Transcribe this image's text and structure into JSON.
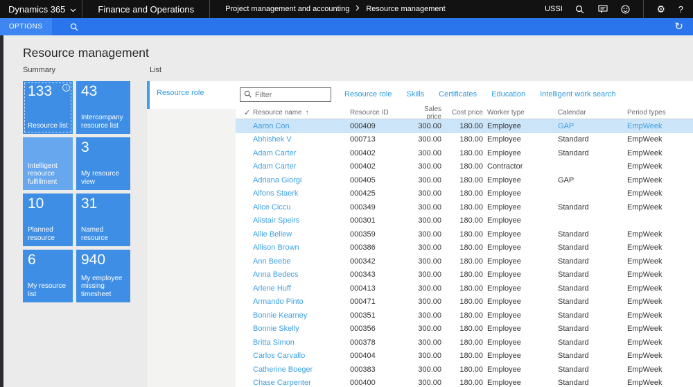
{
  "topbar": {
    "product": "Dynamics 365",
    "app": "Finance and Operations",
    "breadcrumb": {
      "parent": "Project management and accounting",
      "current": "Resource management"
    },
    "company": "USSI",
    "help_label": "?"
  },
  "actionbar": {
    "options_tab": "OPTIONS"
  },
  "page": {
    "title": "Resource management",
    "summary_label": "Summary",
    "list_label": "List"
  },
  "tiles": [
    {
      "count": "133",
      "label": "Resource list",
      "variant": "normal",
      "info": true,
      "focused": true
    },
    {
      "count": "43",
      "label": "Intercompany resource list",
      "variant": "normal"
    },
    {
      "count": "",
      "label": "Intelligent resource fulfillment",
      "variant": "light"
    },
    {
      "count": "3",
      "label": "My resource view",
      "variant": "normal"
    },
    {
      "count": "10",
      "label": "Planned resource",
      "variant": "normal"
    },
    {
      "count": "31",
      "label": "Named resource",
      "variant": "normal"
    },
    {
      "count": "6",
      "label": "My resource list",
      "variant": "normal"
    },
    {
      "count": "940",
      "label": "My employee missing timesheet",
      "variant": "normal"
    }
  ],
  "list_panel": {
    "vertical_tab": "Resource role",
    "filter_placeholder": "Filter",
    "tabs": [
      "Resource role",
      "Skills",
      "Certificates",
      "Education",
      "Intelligent work search"
    ],
    "table": {
      "check_glyph": "✓",
      "sort_arrow": "↑",
      "columns": [
        "Resource name",
        "Resource ID",
        "Sales price",
        "Cost price",
        "Worker type",
        "Calendar",
        "Period types"
      ],
      "rows": [
        {
          "name": "Aaron Con",
          "id": "000409",
          "sales": "300.00",
          "cost": "180.00",
          "worker": "Employee",
          "calendar": "GAP",
          "period": "EmpWeek",
          "selected": true
        },
        {
          "name": "Abhishek V",
          "id": "000713",
          "sales": "300.00",
          "cost": "180.00",
          "worker": "Employee",
          "calendar": "Standard",
          "period": "EmpWeek"
        },
        {
          "name": "Adam Carter",
          "id": "000402",
          "sales": "300.00",
          "cost": "180.00",
          "worker": "Employee",
          "calendar": "Standard",
          "period": "EmpWeek"
        },
        {
          "name": "Adam Carter",
          "id": "000402",
          "sales": "300.00",
          "cost": "180.00",
          "worker": "Contractor",
          "calendar": "",
          "period": "EmpWeek"
        },
        {
          "name": "Adriana Giorgi",
          "id": "000405",
          "sales": "300.00",
          "cost": "180.00",
          "worker": "Employee",
          "calendar": "GAP",
          "period": "EmpWeek"
        },
        {
          "name": "Alfons Staerk",
          "id": "000425",
          "sales": "300.00",
          "cost": "180.00",
          "worker": "Employee",
          "calendar": "",
          "period": "EmpWeek"
        },
        {
          "name": "Alice Ciccu",
          "id": "000349",
          "sales": "300.00",
          "cost": "180.00",
          "worker": "Employee",
          "calendar": "Standard",
          "period": "EmpWeek"
        },
        {
          "name": "Alistair Speirs",
          "id": "000301",
          "sales": "300.00",
          "cost": "180.00",
          "worker": "Employee",
          "calendar": "",
          "period": ""
        },
        {
          "name": "Allie Bellew",
          "id": "000359",
          "sales": "300.00",
          "cost": "180.00",
          "worker": "Employee",
          "calendar": "Standard",
          "period": "EmpWeek"
        },
        {
          "name": "Allison Brown",
          "id": "000386",
          "sales": "300.00",
          "cost": "180.00",
          "worker": "Employee",
          "calendar": "Standard",
          "period": "EmpWeek"
        },
        {
          "name": "Ann Beebe",
          "id": "000342",
          "sales": "300.00",
          "cost": "180.00",
          "worker": "Employee",
          "calendar": "Standard",
          "period": "EmpWeek"
        },
        {
          "name": "Anna Bedecs",
          "id": "000343",
          "sales": "300.00",
          "cost": "180.00",
          "worker": "Employee",
          "calendar": "Standard",
          "period": "EmpWeek"
        },
        {
          "name": "Arlene Huff",
          "id": "000413",
          "sales": "300.00",
          "cost": "180.00",
          "worker": "Employee",
          "calendar": "Standard",
          "period": "EmpWeek"
        },
        {
          "name": "Armando Pinto",
          "id": "000471",
          "sales": "300.00",
          "cost": "180.00",
          "worker": "Employee",
          "calendar": "Standard",
          "period": "EmpWeek"
        },
        {
          "name": "Bonnie Kearney",
          "id": "000351",
          "sales": "300.00",
          "cost": "180.00",
          "worker": "Employee",
          "calendar": "Standard",
          "period": "EmpWeek"
        },
        {
          "name": "Bonnie Skelly",
          "id": "000356",
          "sales": "300.00",
          "cost": "180.00",
          "worker": "Employee",
          "calendar": "Standard",
          "period": "EmpWeek"
        },
        {
          "name": "Britta Simon",
          "id": "000378",
          "sales": "300.00",
          "cost": "180.00",
          "worker": "Employee",
          "calendar": "Standard",
          "period": "EmpWeek"
        },
        {
          "name": "Carlos Carvallo",
          "id": "000404",
          "sales": "300.00",
          "cost": "180.00",
          "worker": "Employee",
          "calendar": "Standard",
          "period": "EmpWeek"
        },
        {
          "name": "Catherine Boeger",
          "id": "000383",
          "sales": "300.00",
          "cost": "180.00",
          "worker": "Employee",
          "calendar": "Standard",
          "period": "EmpWeek"
        },
        {
          "name": "Chase Carpenter",
          "id": "000400",
          "sales": "300.00",
          "cost": "180.00",
          "worker": "Employee",
          "calendar": "Standard",
          "period": "EmpWeek"
        }
      ]
    }
  },
  "colors": {
    "topbar_bg": "#121212",
    "actionbar_bg": "#2a75ec",
    "actionbar_tab_bg": "#3e87f3",
    "tile_blue": "#3e8ee5",
    "tile_light_blue": "#66a7ee",
    "link_blue": "#3b9fe3",
    "selected_row_bg": "#cde5f8",
    "page_bg": "#ebebeb"
  }
}
